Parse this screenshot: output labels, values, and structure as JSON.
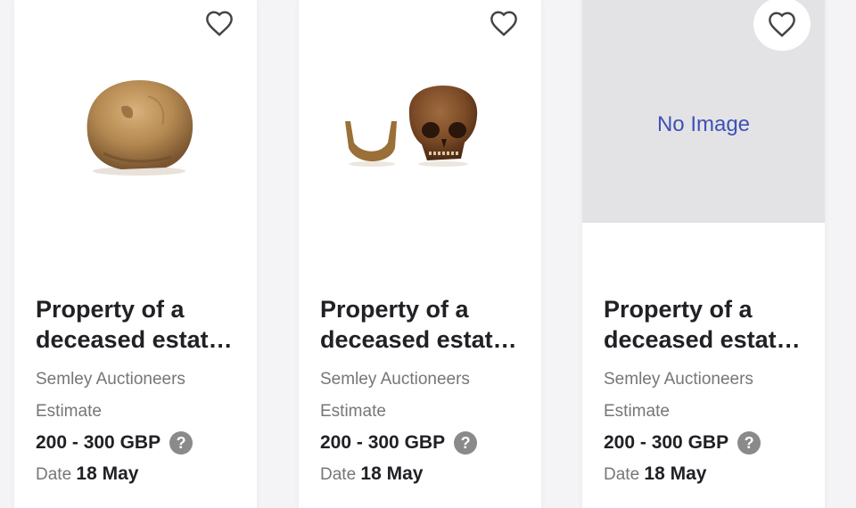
{
  "lots": [
    {
      "image": "skull-cranium-photo",
      "title": "Property of a deceased estat…",
      "seller": "Semley Auctioneers",
      "estimate_label": "Estimate",
      "estimate_value": "200 - 300 GBP",
      "date_label": "Date",
      "date_value": "18 May"
    },
    {
      "image": "skull-with-jaw-photo",
      "title": "Property of a deceased estat…",
      "seller": "Semley Auctioneers",
      "estimate_label": "Estimate",
      "estimate_value": "200 - 300 GBP",
      "date_label": "Date",
      "date_value": "18 May"
    },
    {
      "image": "no-image-placeholder",
      "no_image_text": "No Image",
      "title": "Property of a deceased estat…",
      "seller": "Semley Auctioneers",
      "estimate_label": "Estimate",
      "estimate_value": "200 - 300 GBP",
      "date_label": "Date",
      "date_value": "18 May"
    }
  ],
  "icons": {
    "favorite": "heart-outline-icon",
    "help": "question-circle-icon",
    "help_glyph": "?"
  },
  "colors": {
    "no_image_text": "#3f51b5",
    "placeholder_bg": "#e3e3e6",
    "muted_text": "#767676"
  }
}
